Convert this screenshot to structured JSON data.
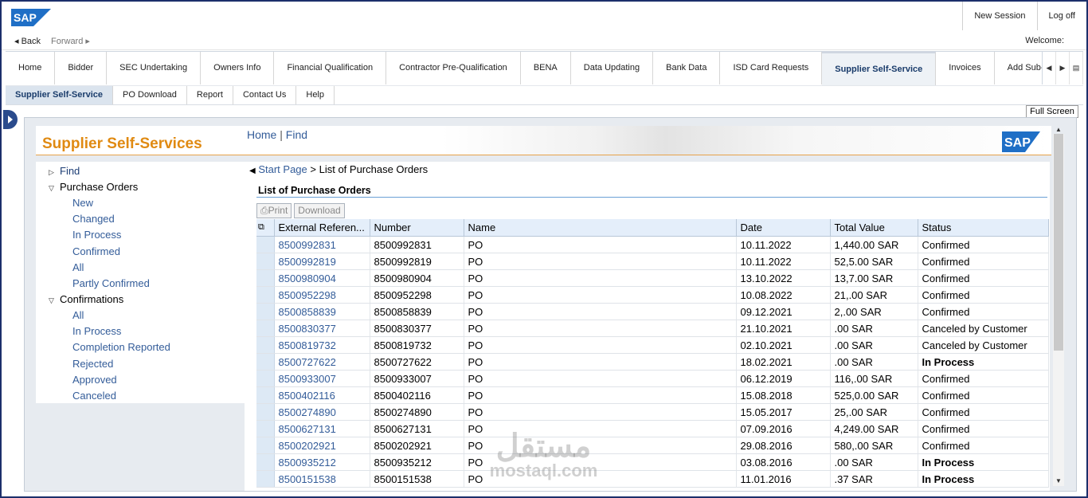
{
  "header": {
    "logo_text": "SAP",
    "new_session": "New Session",
    "log_off": "Log off",
    "back": "Back",
    "forward": "Forward",
    "welcome": "Welcome:"
  },
  "main_tabs": [
    {
      "label": "Home"
    },
    {
      "label": "Bidder"
    },
    {
      "label": "SEC Undertaking"
    },
    {
      "label": "Owners Info"
    },
    {
      "label": "Financial Qualification"
    },
    {
      "label": "Contractor Pre-Qualification"
    },
    {
      "label": "BENA"
    },
    {
      "label": "Data Updating"
    },
    {
      "label": "Bank Data"
    },
    {
      "label": "ISD Card Requests"
    },
    {
      "label": "Supplier Self-Service",
      "active": true
    },
    {
      "label": "Invoices"
    },
    {
      "label": "Add Sub-C"
    }
  ],
  "sub_tabs": [
    {
      "label": "Supplier Self-Service",
      "active": true
    },
    {
      "label": "PO Download"
    },
    {
      "label": "Report"
    },
    {
      "label": "Contact Us"
    },
    {
      "label": "Help"
    }
  ],
  "full_screen": "Full Screen",
  "banner": {
    "title": "Supplier Self-Services",
    "home_link": "Home",
    "separator": "|",
    "find_link": "Find",
    "logo_text": "SAP"
  },
  "left_nav": {
    "find": "Find",
    "purchase_orders": {
      "label": "Purchase Orders",
      "items": [
        "New",
        "Changed",
        "In Process",
        "Confirmed",
        "All",
        "Partly Confirmed"
      ]
    },
    "confirmations": {
      "label": "Confirmations",
      "items": [
        "All",
        "In Process",
        "Completion Reported",
        "Rejected",
        "Approved",
        "Canceled"
      ]
    }
  },
  "breadcrumb": {
    "start": "Start Page",
    "sep": ">",
    "current": "List of Purchase Orders"
  },
  "list": {
    "title": "List of Purchase Orders",
    "print": "Print",
    "download": "Download",
    "columns": [
      "External Referen...",
      "Number",
      "Name",
      "Date",
      "Total Value",
      "Status"
    ],
    "rows": [
      {
        "ref": "8500992831",
        "number": "8500992831",
        "name": "PO",
        "date": "10.11.2022",
        "value": "1,440.00 SAR",
        "status": "Confirmed",
        "bold": false
      },
      {
        "ref": "8500992819",
        "number": "8500992819",
        "name": "PO",
        "date": "10.11.2022",
        "value": "52,5.00 SAR",
        "status": "Confirmed",
        "bold": false
      },
      {
        "ref": "8500980904",
        "number": "8500980904",
        "name": "PO",
        "date": "13.10.2022",
        "value": "13,7.00 SAR",
        "status": "Confirmed",
        "bold": false
      },
      {
        "ref": "8500952298",
        "number": "8500952298",
        "name": "PO",
        "date": "10.08.2022",
        "value": "21,.00 SAR",
        "status": "Confirmed",
        "bold": false
      },
      {
        "ref": "8500858839",
        "number": "8500858839",
        "name": "PO",
        "date": "09.12.2021",
        "value": "2,.00 SAR",
        "status": "Confirmed",
        "bold": false
      },
      {
        "ref": "8500830377",
        "number": "8500830377",
        "name": "PO",
        "date": "21.10.2021",
        "value": ".00 SAR",
        "status": "Canceled by Customer",
        "bold": false
      },
      {
        "ref": "8500819732",
        "number": "8500819732",
        "name": "PO",
        "date": "02.10.2021",
        "value": ".00 SAR",
        "status": "Canceled by Customer",
        "bold": false
      },
      {
        "ref": "8500727622",
        "number": "8500727622",
        "name": "PO",
        "date": "18.02.2021",
        "value": ".00 SAR",
        "status": "In Process",
        "bold": true
      },
      {
        "ref": "8500933007",
        "number": "8500933007",
        "name": "PO",
        "date": "06.12.2019",
        "value": "116,.00 SAR",
        "status": "Confirmed",
        "bold": false
      },
      {
        "ref": "8500402116",
        "number": "8500402116",
        "name": "PO",
        "date": "15.08.2018",
        "value": "525,0.00 SAR",
        "status": "Confirmed",
        "bold": false
      },
      {
        "ref": "8500274890",
        "number": "8500274890",
        "name": "PO",
        "date": "15.05.2017",
        "value": "25,.00 SAR",
        "status": "Confirmed",
        "bold": false
      },
      {
        "ref": "8500627131",
        "number": "8500627131",
        "name": "PO",
        "date": "07.09.2016",
        "value": "4,249.00 SAR",
        "status": "Confirmed",
        "bold": false
      },
      {
        "ref": "8500202921",
        "number": "8500202921",
        "name": "PO",
        "date": "29.08.2016",
        "value": "580,.00 SAR",
        "status": "Confirmed",
        "bold": false
      },
      {
        "ref": "8500935212",
        "number": "8500935212",
        "name": "PO",
        "date": "03.08.2016",
        "value": ".00 SAR",
        "status": "In Process",
        "bold": true
      },
      {
        "ref": "8500151538",
        "number": "8500151538",
        "name": "PO",
        "date": "11.01.2016",
        "value": ".37 SAR",
        "status": "In Process",
        "bold": true
      }
    ]
  },
  "watermark": {
    "arabic": "مستقل",
    "latin": "mostaql.com"
  },
  "colors": {
    "accent_orange": "#e08a12",
    "link_blue": "#335c99",
    "header_blue": "#1c2f6b"
  }
}
